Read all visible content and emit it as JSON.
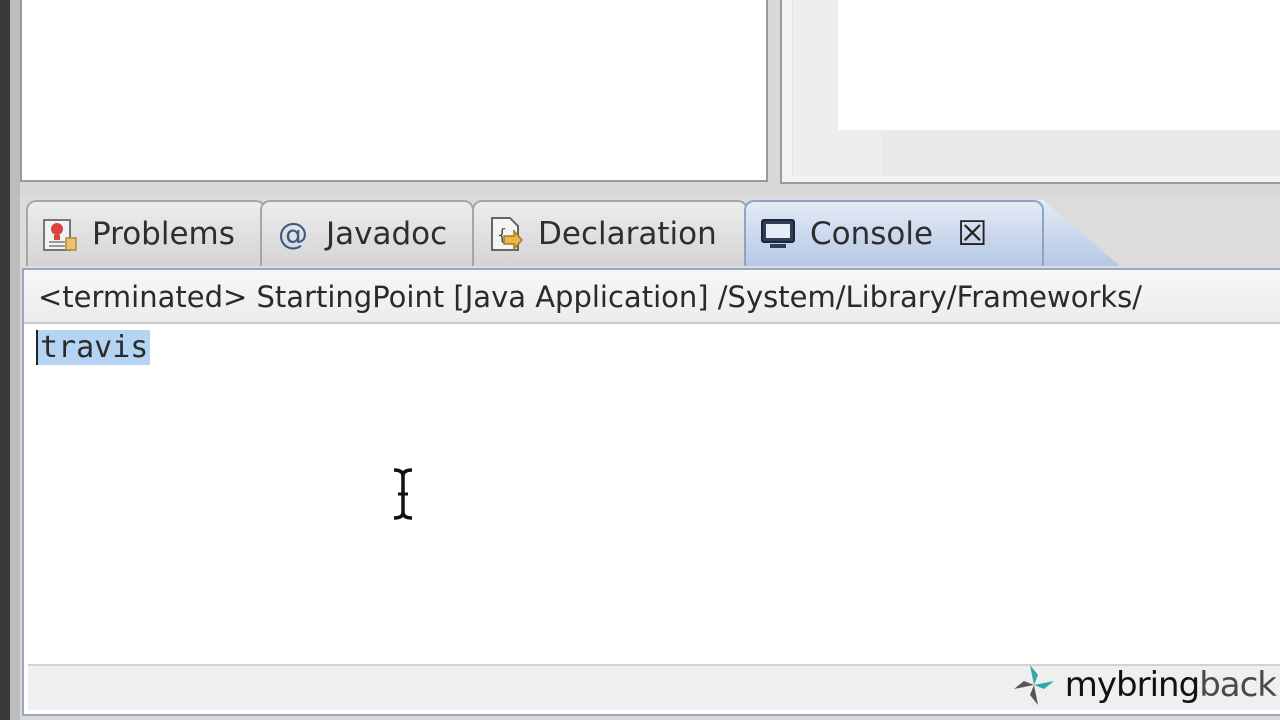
{
  "tabs": [
    {
      "label": "Problems",
      "icon": "problems-icon",
      "active": false
    },
    {
      "label": "Javadoc",
      "icon": "at-sign-icon",
      "active": false
    },
    {
      "label": "Declaration",
      "icon": "declaration-icon",
      "active": false
    },
    {
      "label": "Console",
      "icon": "console-icon",
      "active": true
    }
  ],
  "console": {
    "header": "<terminated> StartingPoint [Java Application] /System/Library/Frameworks/",
    "output": "travis",
    "close_glyph": "☒"
  },
  "watermark": {
    "part1": "my",
    "part2": "bring",
    "part3": "back"
  },
  "colors": {
    "active_tab": "#b5c8e4",
    "selection": "#b5d3f2"
  }
}
